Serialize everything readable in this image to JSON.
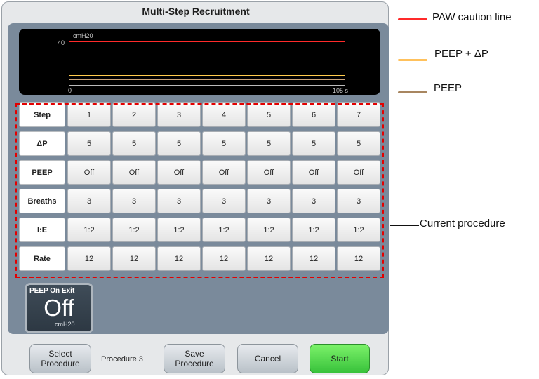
{
  "window": {
    "title": "Multi-Step Recruitment"
  },
  "graph": {
    "unit": "cmH20",
    "y_max_label": "40",
    "x_start_label": "0",
    "x_end_label": "105 s",
    "lines": {
      "paw_caution": "#ff2a2a",
      "peep_plus_dp": "#ffcc4d",
      "peep": "#c9a37a"
    }
  },
  "table": {
    "row_labels": [
      "Step",
      "ΔP",
      "PEEP",
      "Breaths",
      "I:E",
      "Rate"
    ],
    "rows": [
      [
        "1",
        "2",
        "3",
        "4",
        "5",
        "6",
        "7"
      ],
      [
        "5",
        "5",
        "5",
        "5",
        "5",
        "5",
        "5"
      ],
      [
        "Off",
        "Off",
        "Off",
        "Off",
        "Off",
        "Off",
        "Off"
      ],
      [
        "3",
        "3",
        "3",
        "3",
        "3",
        "3",
        "3"
      ],
      [
        "1:2",
        "1:2",
        "1:2",
        "1:2",
        "1:2",
        "1:2",
        "1:2"
      ],
      [
        "12",
        "12",
        "12",
        "12",
        "12",
        "12",
        "12"
      ]
    ]
  },
  "peep_on_exit": {
    "label": "PEEP On Exit",
    "value": "Off",
    "unit": "cmH20"
  },
  "footer": {
    "select_line1": "Select",
    "select_line2": "Procedure",
    "procedure_name": "Procedure 3",
    "save_line1": "Save",
    "save_line2": "Procedure",
    "cancel": "Cancel",
    "start": "Start"
  },
  "legend": {
    "paw_caution": "PAW caution line",
    "peep_dp": "PEEP + ΔP",
    "peep": "PEEP",
    "current_procedure": "Current procedure",
    "colors": {
      "paw": "#ff2a2a",
      "peep_dp": "#ffc15c",
      "peep": "#a88660"
    }
  }
}
